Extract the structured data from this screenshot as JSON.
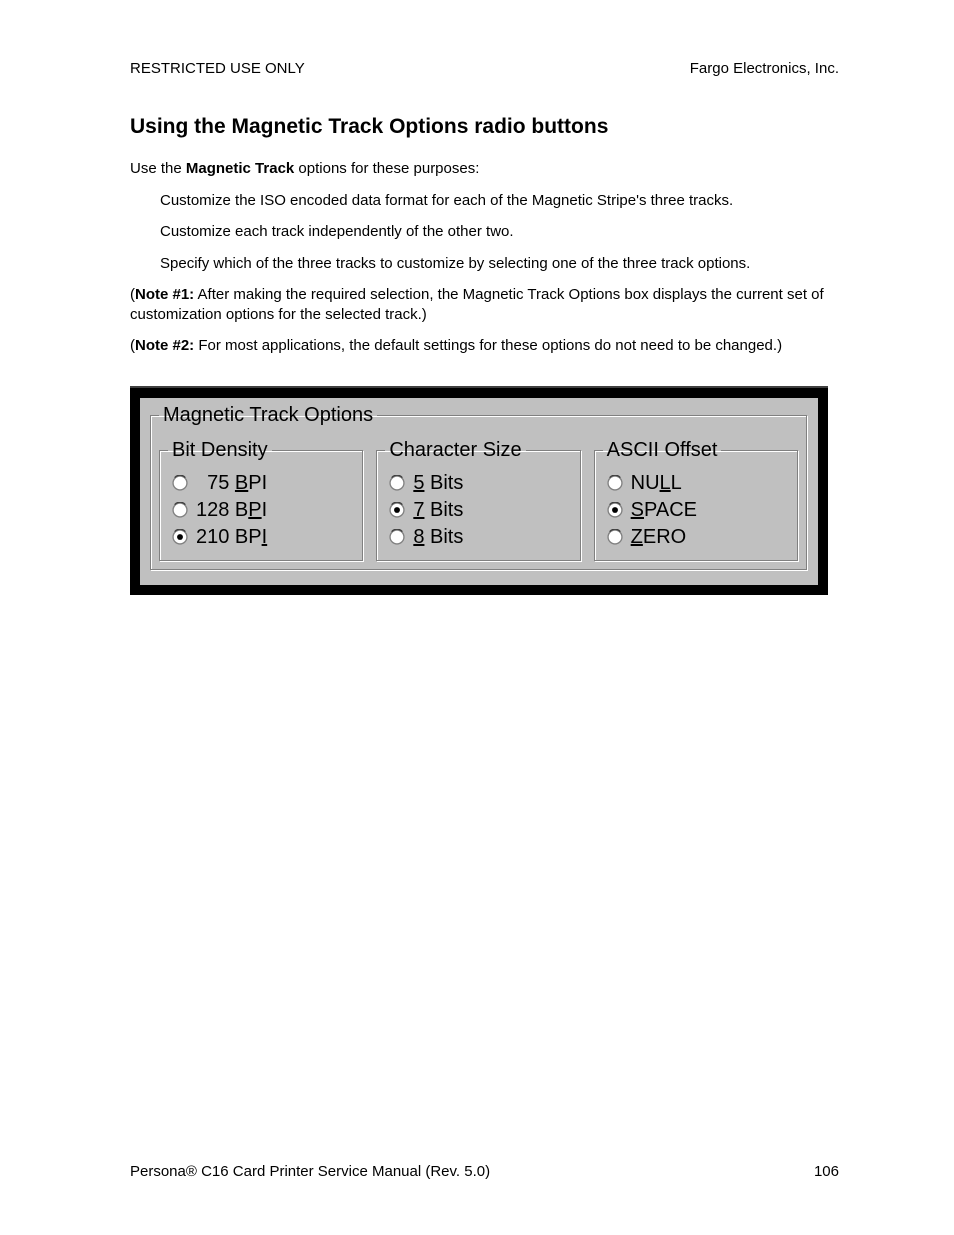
{
  "header": {
    "left": "RESTRICTED USE ONLY",
    "right": "Fargo Electronics, Inc."
  },
  "title": "Using the Magnetic Track Options radio buttons",
  "intro_pre": "Use the ",
  "intro_bold": "Magnetic Track",
  "intro_post": " options for these purposes:",
  "bullets": [
    "Customize the ISO encoded data format for each of the Magnetic Stripe's three tracks.",
    "Customize each track independently of the other two.",
    "Specify which of the three tracks to customize by selecting one of the three track options."
  ],
  "note1_label": "Note #1:",
  "note1_text": "  After making the required selection, the Magnetic Track Options box displays the current set of customization options for the selected track.)",
  "note2_label": "Note #2:",
  "note2_text": "  For most applications, the default settings for these options do not need to be changed.)",
  "dialog": {
    "main_legend": "Magnetic Track Options",
    "groups": [
      {
        "legend": "Bit Density",
        "options": [
          {
            "pre": "  75 ",
            "u": "B",
            "post": "PI",
            "selected": false
          },
          {
            "pre": "128 B",
            "u": "P",
            "post": "I",
            "selected": false
          },
          {
            "pre": "210 BP",
            "u": "I",
            "post": "",
            "selected": true
          }
        ]
      },
      {
        "legend": "Character Size",
        "options": [
          {
            "pre": "",
            "u": "5",
            "post": " Bits",
            "selected": false
          },
          {
            "pre": "",
            "u": "7",
            "post": " Bits",
            "selected": true
          },
          {
            "pre": "",
            "u": "8",
            "post": " Bits",
            "selected": false
          }
        ]
      },
      {
        "legend": "ASCII Offset",
        "options": [
          {
            "pre": "NU",
            "u": "L",
            "post": "L",
            "selected": false
          },
          {
            "pre": "",
            "u": "S",
            "post": "PACE",
            "selected": true
          },
          {
            "pre": "",
            "u": "Z",
            "post": "ERO",
            "selected": false
          }
        ]
      }
    ]
  },
  "footer": {
    "left": "Persona® C16 Card Printer Service Manual (Rev. 5.0)",
    "right": "106"
  }
}
